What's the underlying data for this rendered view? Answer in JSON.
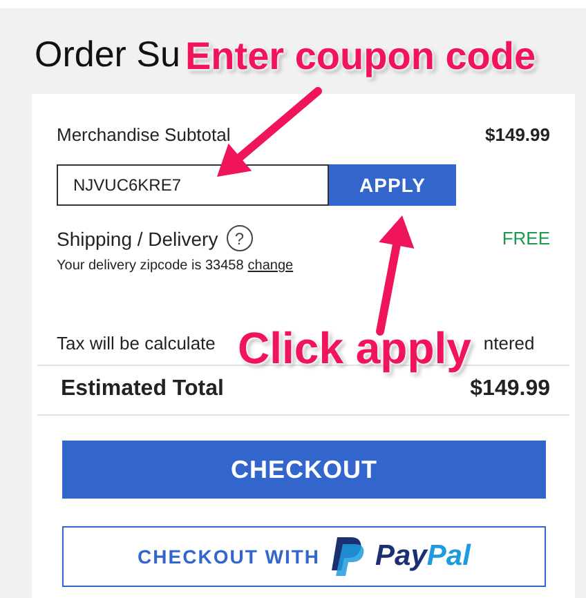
{
  "title": "Order Su",
  "merchandise": {
    "label": "Merchandise Subtotal",
    "value": "$149.99"
  },
  "coupon": {
    "value": "NJVUC6KRE7",
    "button": "APPLY"
  },
  "shipping": {
    "label": "Shipping / Delivery",
    "help": "?",
    "value": "FREE",
    "zip_text": "Your delivery zipcode is 33458",
    "zip_link": "change"
  },
  "tax": {
    "start": "Tax will be calculate",
    "end": "ntered"
  },
  "total": {
    "label": "Estimated Total",
    "value": "$149.99"
  },
  "checkout_button": "CHECKOUT",
  "paypal_button": {
    "label": "CHECKOUT WITH",
    "wordmark_first": "Pay",
    "wordmark_second": "Pal"
  },
  "annotations": [
    {
      "kind": "coupon",
      "text": "Enter coupon code"
    },
    {
      "kind": "apply",
      "text": "Click apply"
    }
  ]
}
